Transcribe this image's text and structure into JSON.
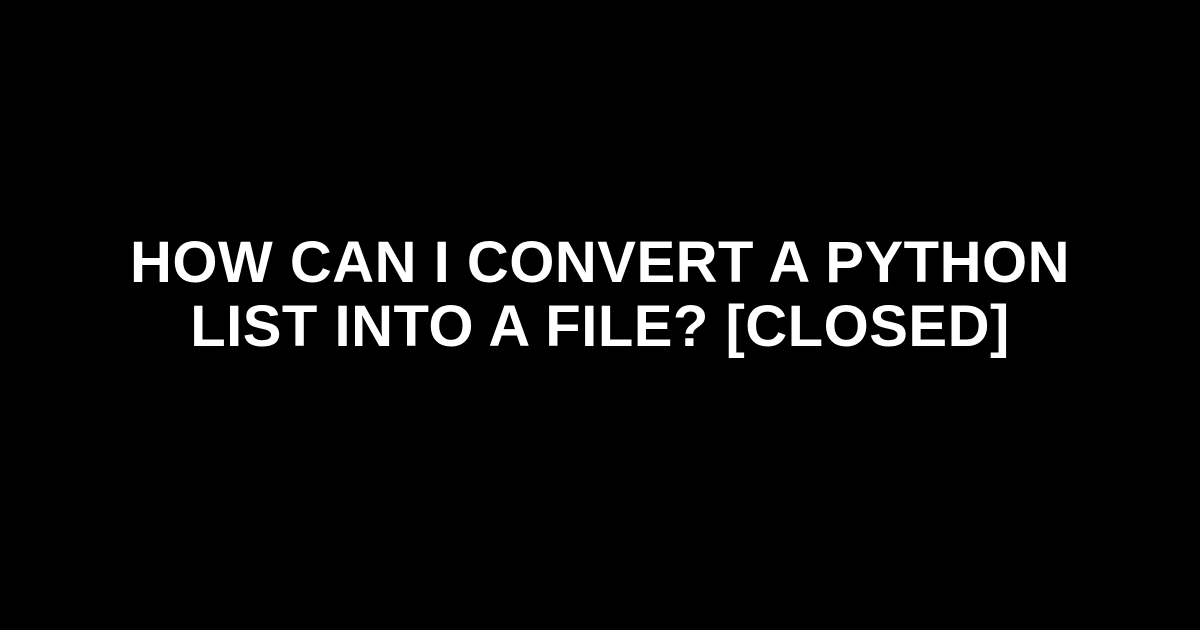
{
  "title": "How can I convert a Python list into a file? [closed]"
}
